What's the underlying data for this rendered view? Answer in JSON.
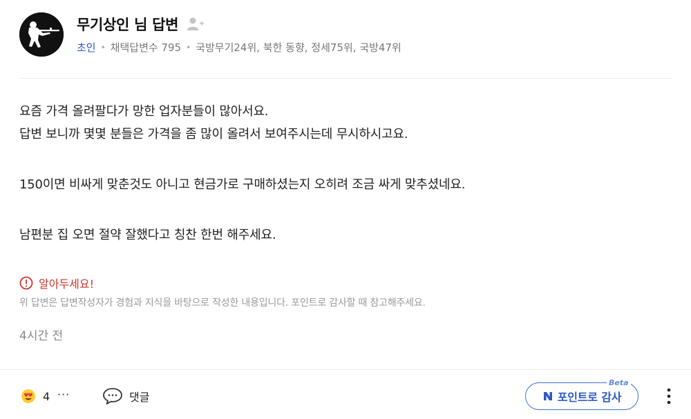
{
  "author": {
    "name": "무기상인 님 답변",
    "grade": "초인",
    "adopted": "채택답변수 795",
    "ranks": "국방무기24위, 북한 동향, 정세75위, 국방47위"
  },
  "answer": {
    "paragraphs": [
      [
        "요즘 가격 올려팔다가 망한 업자분들이 많아서요.",
        "답변 보니까 몇몇 분들은 가격을 좀 많이 올려서 보여주시는데 무시하시고요."
      ],
      [
        "150이면 비싸게 맞춘것도 아니고 현금가로 구매하셨는지 오히려 조금 싸게 맞추셨네요."
      ],
      [
        "남편분 집 오면 절약 잘했다고 칭찬 한번 해주세요."
      ]
    ]
  },
  "notice": {
    "title": "알아두세요!",
    "description": "위 답변은 답변작성자가 경험과 지식을 바탕으로 작성한 내용입니다. 포인트로 감사할 때 참고해주세요."
  },
  "time": "4시간 전",
  "footer": {
    "reaction_count": "4",
    "more_label": "···",
    "comment_label": "댓글",
    "point_label": "포인트로 감사",
    "beta_label": "Beta"
  },
  "colors": {
    "accent": "#2a59c4",
    "notice": "#d0342c",
    "muted": "#777777"
  },
  "icons": {
    "avatar": "soldier-silhouette-icon",
    "follow": "add-person-icon",
    "notice": "exclamation-circle-icon",
    "reaction": "heart-eyes-emoji-icon",
    "comment": "speech-bubble-icon",
    "point": "naver-n-icon",
    "kebab": "vertical-dots-icon"
  }
}
